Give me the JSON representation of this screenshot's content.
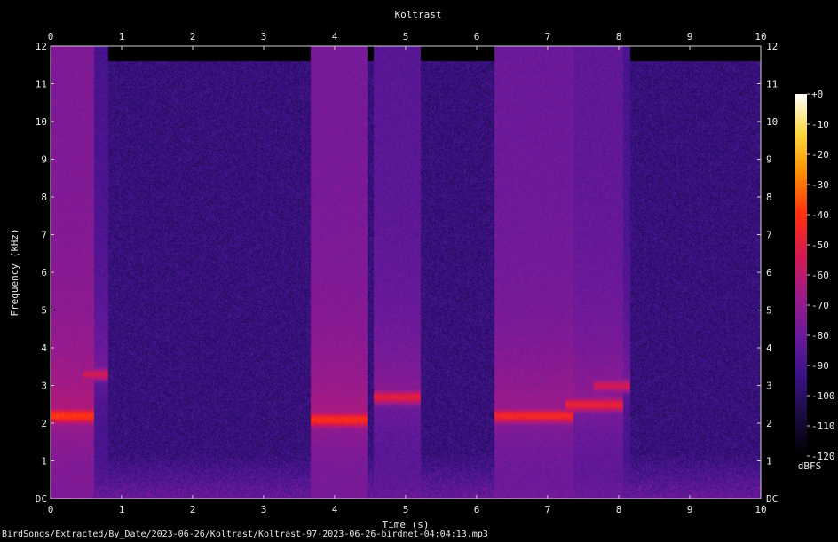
{
  "chart_data": {
    "type": "heatmap",
    "title": "Koltrast",
    "xlabel": "Time (s)",
    "ylabel": "Frequency (kHz)",
    "xlim": [
      0,
      10
    ],
    "ylim": [
      0,
      12
    ],
    "x_ticks": [
      "0",
      "1",
      "2",
      "3",
      "4",
      "5",
      "6",
      "7",
      "8",
      "9",
      "10"
    ],
    "y_ticks": [
      "DC",
      "1",
      "2",
      "3",
      "4",
      "5",
      "6",
      "7",
      "8",
      "9",
      "10",
      "11",
      "12"
    ],
    "colorbar": {
      "label": "dBFS",
      "range": [
        -120,
        0
      ],
      "ticks": [
        "+0",
        "-10",
        "-20",
        "-30",
        "-40",
        "-50",
        "-60",
        "-70",
        "-80",
        "-90",
        "-100",
        "-110",
        "-120"
      ],
      "colors": [
        "#000000",
        "#1a0a40",
        "#3a1288",
        "#6a1a9c",
        "#a01a8a",
        "#d81850",
        "#ff3010",
        "#ff8a00",
        "#ffd83a",
        "#ffffff"
      ]
    },
    "noise_floor_dbfs": -95,
    "events": [
      {
        "t0": 0.0,
        "t1": 0.55,
        "f_khz": 2.2,
        "peak_dbfs": -40
      },
      {
        "t0": 0.5,
        "t1": 0.75,
        "f_khz": 3.3,
        "peak_dbfs": -55
      },
      {
        "t0": 3.7,
        "t1": 4.4,
        "f_khz": 2.1,
        "peak_dbfs": -42
      },
      {
        "t0": 4.6,
        "t1": 5.15,
        "f_khz": 2.7,
        "peak_dbfs": -50
      },
      {
        "t0": 6.3,
        "t1": 7.3,
        "f_khz": 2.2,
        "peak_dbfs": -45
      },
      {
        "t0": 7.3,
        "t1": 8.0,
        "f_khz": 2.5,
        "peak_dbfs": -48
      },
      {
        "t0": 7.7,
        "t1": 8.1,
        "f_khz": 3.0,
        "peak_dbfs": -55
      }
    ]
  },
  "footer": {
    "file_path": "BirdSongs/Extracted/By_Date/2023-06-26/Koltrast/Koltrast-97-2023-06-26-birdnet-04:04:13.mp3"
  }
}
